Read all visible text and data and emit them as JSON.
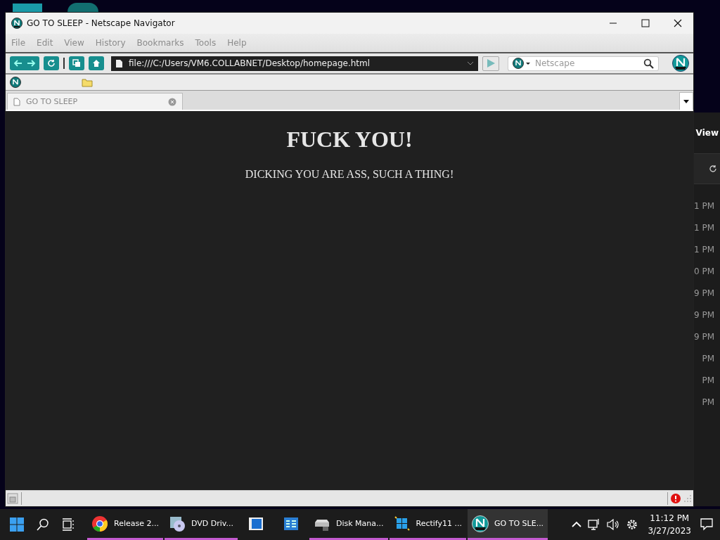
{
  "window": {
    "title": "GO TO SLEEP - Netscape Navigator"
  },
  "menu": [
    "File",
    "Edit",
    "View",
    "History",
    "Bookmarks",
    "Tools",
    "Help"
  ],
  "address": {
    "value": "file:///C:/Users/VM6.COLLABNET/Desktop/homepage.html"
  },
  "search": {
    "placeholder": "Netscape"
  },
  "tabs": [
    {
      "label": "GO TO SLEEP",
      "selected": true
    }
  ],
  "page": {
    "heading": "FUCK YOU!",
    "text": "DICKING YOU ARE ASS, SUCH A THING!"
  },
  "background_window": {
    "view": "View",
    "times": [
      "1 PM",
      "1 PM",
      "1 PM",
      "0 PM",
      "9 PM",
      "9 PM",
      "9 PM",
      "PM",
      "PM",
      "PM"
    ]
  },
  "taskbar": {
    "apps": [
      {
        "kind": "chrome",
        "label": "Release 2...",
        "running": true,
        "selected": false
      },
      {
        "kind": "dvd",
        "label": "DVD Driv...",
        "running": true,
        "selected": false
      },
      {
        "kind": "window",
        "running": false,
        "selected": false
      },
      {
        "kind": "control",
        "running": false,
        "selected": false
      },
      {
        "kind": "disk",
        "label": "Disk Mana...",
        "running": true,
        "selected": false
      },
      {
        "kind": "rectify",
        "label": "Rectify11 ...",
        "running": true,
        "selected": false
      },
      {
        "kind": "netscape",
        "label": "GO TO SLE...",
        "running": true,
        "selected": true
      }
    ],
    "time": "11:12 PM",
    "date": "3/27/2023"
  }
}
